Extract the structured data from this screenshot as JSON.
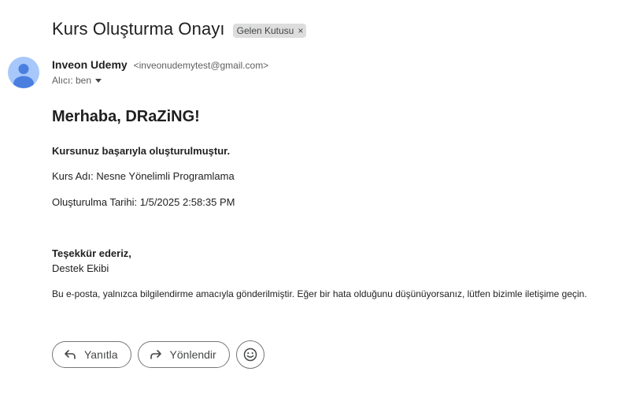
{
  "email": {
    "subject": "Kurs Oluşturma Onayı",
    "label": "Gelen Kutusu",
    "label_remove": "×",
    "sender_name": "Inveon Udemy",
    "sender_email": "<inveonudemytest@gmail.com>",
    "recipient": "Alıcı: ben"
  },
  "message": {
    "greeting": "Merhaba, DRaZiNG!",
    "success": "Kursunuz başarıyla oluşturulmuştur.",
    "course_line": "Kurs Adı: Nesne Yönelimli Programlama",
    "created_line": "Oluşturulma Tarihi: 1/5/2025 2:58:35 PM",
    "thanks": "Teşekkür ederiz,",
    "team": "Destek Ekibi",
    "note": "Bu e-posta, yalnızca bilgilendirme amacıyla gönderilmiştir. Eğer bir hata olduğunu düşünüyorsanız, lütfen bizimle iletişime geçin."
  },
  "actions": {
    "reply": "Yanıtla",
    "forward": "Yönlendir"
  },
  "icons": [
    "avatar-person-icon",
    "reply-icon",
    "forward-icon",
    "emoji-icon",
    "chevron-down-icon"
  ],
  "colors": {
    "avatar_bg": "#a8c7fa",
    "avatar_fg": "#4a7fe0",
    "label_bg": "#dddddd"
  }
}
